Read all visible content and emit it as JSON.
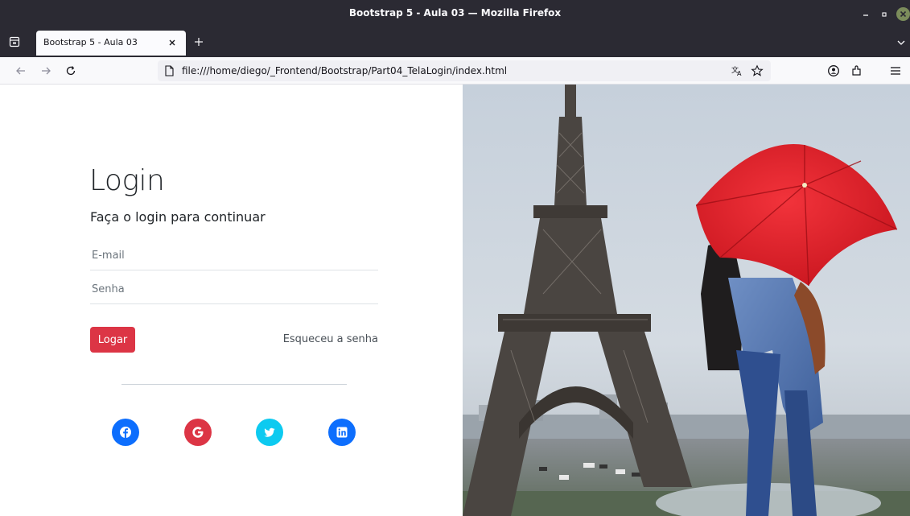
{
  "window": {
    "title": "Bootstrap 5 - Aula 03 — Mozilla Firefox"
  },
  "tabs": [
    {
      "label": "Bootstrap 5 - Aula 03",
      "active": true
    }
  ],
  "navbar": {
    "url": "file:///home/diego/_Frontend/Bootstrap/Part04_TelaLogin/index.html"
  },
  "login": {
    "title": "Login",
    "subtitle": "Faça o login para continuar",
    "email_placeholder": "E-mail",
    "password_placeholder": "Senha",
    "submit_label": "Logar",
    "forgot_label": "Esqueceu a senha"
  },
  "social": [
    {
      "name": "facebook",
      "icon": "facebook-icon",
      "color": "#0d6efd"
    },
    {
      "name": "google",
      "icon": "google-icon",
      "color": "#dc3545"
    },
    {
      "name": "twitter",
      "icon": "twitter-icon",
      "color": "#0dcaf0"
    },
    {
      "name": "linkedin",
      "icon": "linkedin-icon",
      "color": "#0d6efd"
    }
  ],
  "colors": {
    "primary": "#0d6efd",
    "danger": "#dc3545",
    "info": "#0dcaf0",
    "titlebar": "#2b2a33"
  },
  "hero_image": {
    "subject": "eiffel-tower-couple-red-umbrella"
  }
}
